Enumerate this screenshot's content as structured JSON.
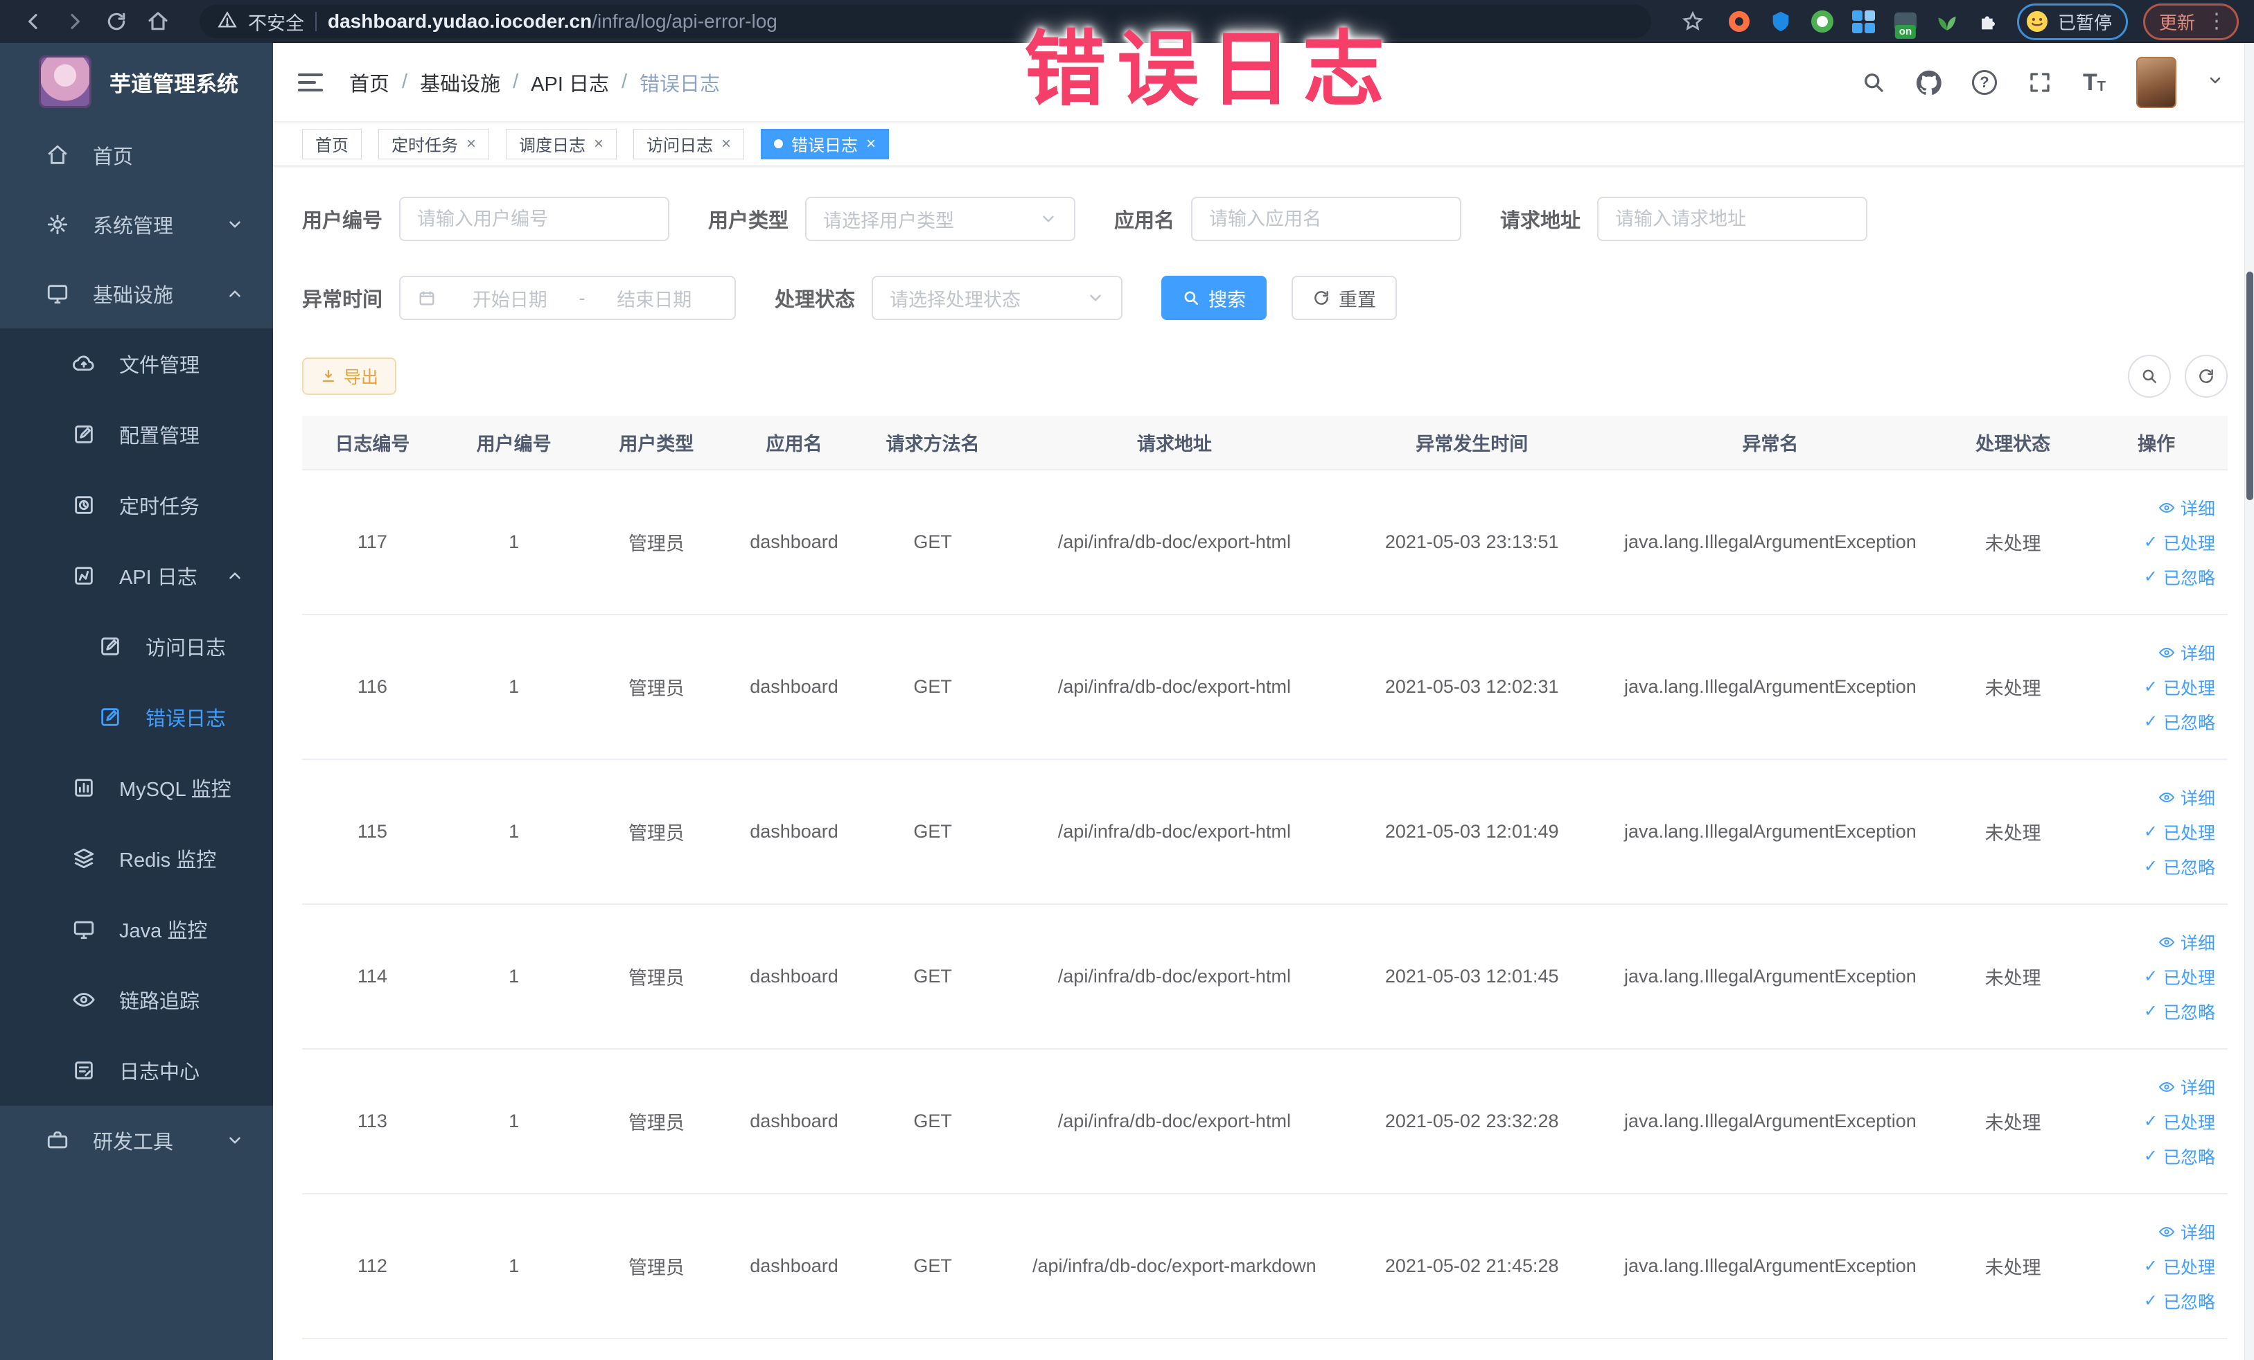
{
  "overlay": {
    "title": "错误日志"
  },
  "icons": {
    "question": "?",
    "text_size": "T",
    "check": "✓",
    "menu_dots": "⋮",
    "close": "×",
    "breadcrumb_separator": "/"
  },
  "browser": {
    "security": "不安全",
    "url_domain": "dashboard.yudao.iocoder.cn",
    "url_path": "/infra/log/api-error-log",
    "on_badge": "on",
    "paused_label": "已暂停",
    "update_label": "更新"
  },
  "sidebar": {
    "title": "芋道管理系统",
    "menu": [
      {
        "label": "首页"
      },
      {
        "label": "系统管理"
      },
      {
        "label": "基础设施"
      },
      {
        "label": "文件管理"
      },
      {
        "label": "配置管理"
      },
      {
        "label": "定时任务"
      },
      {
        "label": "API 日志"
      },
      {
        "label": "访问日志"
      },
      {
        "label": "错误日志"
      },
      {
        "label": "MySQL 监控"
      },
      {
        "label": "Redis 监控"
      },
      {
        "label": "Java 监控"
      },
      {
        "label": "链路追踪"
      },
      {
        "label": "日志中心"
      },
      {
        "label": "研发工具"
      }
    ]
  },
  "breadcrumb": {
    "items": [
      "首页",
      "基础设施",
      "API 日志",
      "错误日志"
    ]
  },
  "tabs": [
    {
      "label": "首页"
    },
    {
      "label": "定时任务"
    },
    {
      "label": "调度日志"
    },
    {
      "label": "访问日志"
    },
    {
      "label": "错误日志"
    }
  ],
  "filters": {
    "user_id_label": "用户编号",
    "user_id_placeholder": "请输入用户编号",
    "user_type_label": "用户类型",
    "user_type_placeholder": "请选择用户类型",
    "app_name_label": "应用名",
    "app_name_placeholder": "请输入应用名",
    "request_url_label": "请求地址",
    "request_url_placeholder": "请输入请求地址",
    "exception_time_label": "异常时间",
    "date_start_placeholder": "开始日期",
    "date_separator": "-",
    "date_end_placeholder": "结束日期",
    "process_status_label": "处理状态",
    "process_status_placeholder": "请选择处理状态",
    "search_label": "搜索",
    "reset_label": "重置"
  },
  "toolbar": {
    "export_label": "导出"
  },
  "table": {
    "columns": [
      "日志编号",
      "用户编号",
      "用户类型",
      "应用名",
      "请求方法名",
      "请求地址",
      "异常发生时间",
      "异常名",
      "处理状态",
      "操作"
    ],
    "action_labels": {
      "detail": "详细",
      "processed": "已处理",
      "ignored": "已忽略"
    },
    "rows": [
      {
        "id": "117",
        "user_id": "1",
        "user_type": "管理员",
        "app_name": "dashboard",
        "method": "GET",
        "url": "/api/infra/db-doc/export-html",
        "time": "2021-05-03 23:13:51",
        "exception": "java.lang.IllegalArgumentException",
        "status": "未处理"
      },
      {
        "id": "116",
        "user_id": "1",
        "user_type": "管理员",
        "app_name": "dashboard",
        "method": "GET",
        "url": "/api/infra/db-doc/export-html",
        "time": "2021-05-03 12:02:31",
        "exception": "java.lang.IllegalArgumentException",
        "status": "未处理"
      },
      {
        "id": "115",
        "user_id": "1",
        "user_type": "管理员",
        "app_name": "dashboard",
        "method": "GET",
        "url": "/api/infra/db-doc/export-html",
        "time": "2021-05-03 12:01:49",
        "exception": "java.lang.IllegalArgumentException",
        "status": "未处理"
      },
      {
        "id": "114",
        "user_id": "1",
        "user_type": "管理员",
        "app_name": "dashboard",
        "method": "GET",
        "url": "/api/infra/db-doc/export-html",
        "time": "2021-05-03 12:01:45",
        "exception": "java.lang.IllegalArgumentException",
        "status": "未处理"
      },
      {
        "id": "113",
        "user_id": "1",
        "user_type": "管理员",
        "app_name": "dashboard",
        "method": "GET",
        "url": "/api/infra/db-doc/export-html",
        "time": "2021-05-02 23:32:28",
        "exception": "java.lang.IllegalArgumentException",
        "status": "未处理"
      },
      {
        "id": "112",
        "user_id": "1",
        "user_type": "管理员",
        "app_name": "dashboard",
        "method": "GET",
        "url": "/api/infra/db-doc/export-markdown",
        "time": "2021-05-02 21:45:28",
        "exception": "java.lang.IllegalArgumentException",
        "status": "未处理"
      }
    ]
  }
}
